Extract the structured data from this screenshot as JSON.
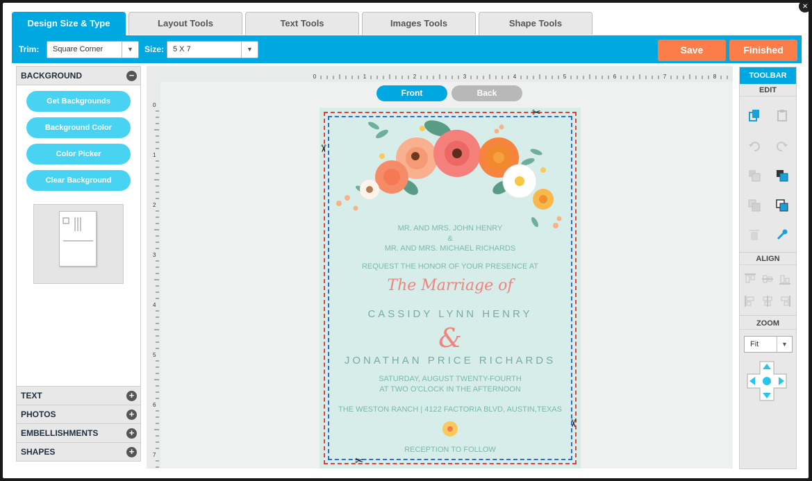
{
  "tabs": [
    "Design Size & Type",
    "Layout Tools",
    "Text Tools",
    "Images Tools",
    "Shape Tools"
  ],
  "topbar": {
    "trim_label": "Trim:",
    "trim_value": "Square Corner",
    "size_label": "Size:",
    "size_value": "5 X 7",
    "save": "Save",
    "finished": "Finished"
  },
  "left_panel": {
    "background_header": "BACKGROUND",
    "buttons": [
      "Get Backgrounds",
      "Background Color",
      "Color Picker",
      "Clear Background"
    ],
    "sections": [
      "TEXT",
      "PHOTOS",
      "EMBELLISHMENTS",
      "SHAPES"
    ]
  },
  "canvas": {
    "front": "Front",
    "back": "Back",
    "ruler_top": [
      "0",
      "1",
      "2",
      "3",
      "4",
      "5",
      "6",
      "7",
      "8"
    ],
    "ruler_left": [
      "0",
      "1",
      "2",
      "3",
      "4",
      "5",
      "6",
      "7"
    ]
  },
  "card": {
    "hosts_1": "MR. AND MRS. JOHN HENRY",
    "amp_small": "&",
    "hosts_2": "MR. AND MRS. MICHAEL RICHARDS",
    "request": "REQUEST THE HONOR OF YOUR PRESENCE AT",
    "marriage": "The Marriage of",
    "bride": "CASSIDY LYNN HENRY",
    "amp": "&",
    "groom": "JONATHAN PRICE RICHARDS",
    "date": "SATURDAY, AUGUST TWENTY-FOURTH",
    "time": "AT TWO O'CLOCK IN THE AFTERNOON",
    "venue": "THE WESTON RANCH  |  4122 FACTORIA BLVD, AUSTIN,TEXAS",
    "reception": "RECEPTION TO FOLLOW"
  },
  "toolbar": {
    "title": "TOOLBAR",
    "edit": "EDIT",
    "align": "ALIGN",
    "zoom": "ZOOM",
    "zoom_value": "Fit"
  },
  "colors": {
    "accent_blue": "#00a8e1",
    "orange": "#fb7e4a",
    "pill_blue": "#49d3f2",
    "card_bg": "#d6ede9"
  }
}
